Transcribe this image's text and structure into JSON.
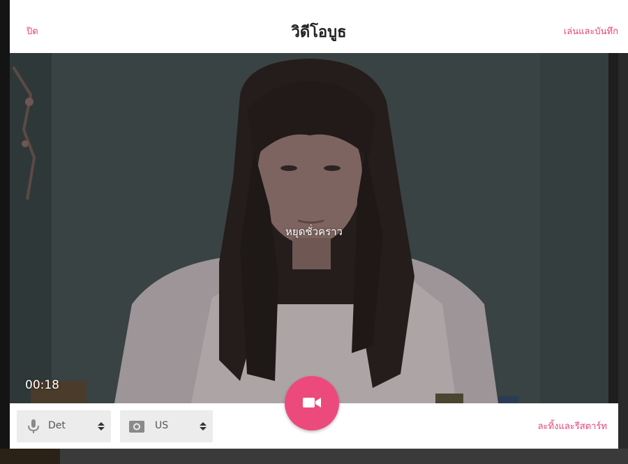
{
  "header": {
    "close_label": "ปิด",
    "title": "วิดีโอบูธ",
    "play_save_label": "เล่นและบันทึก"
  },
  "video": {
    "status_label": "หยุดชั่วคราว",
    "timer": "00:18"
  },
  "controls": {
    "mic_select": {
      "value": "Det",
      "icon": "microphone-icon"
    },
    "camera_select": {
      "value": "US",
      "icon": "camera-icon"
    },
    "record_icon": "video-camera-icon",
    "restart_label": "ละทิ้งและรีสตาร์ท"
  },
  "colors": {
    "accent": "#ec4a7d",
    "link": "#e8427a"
  }
}
